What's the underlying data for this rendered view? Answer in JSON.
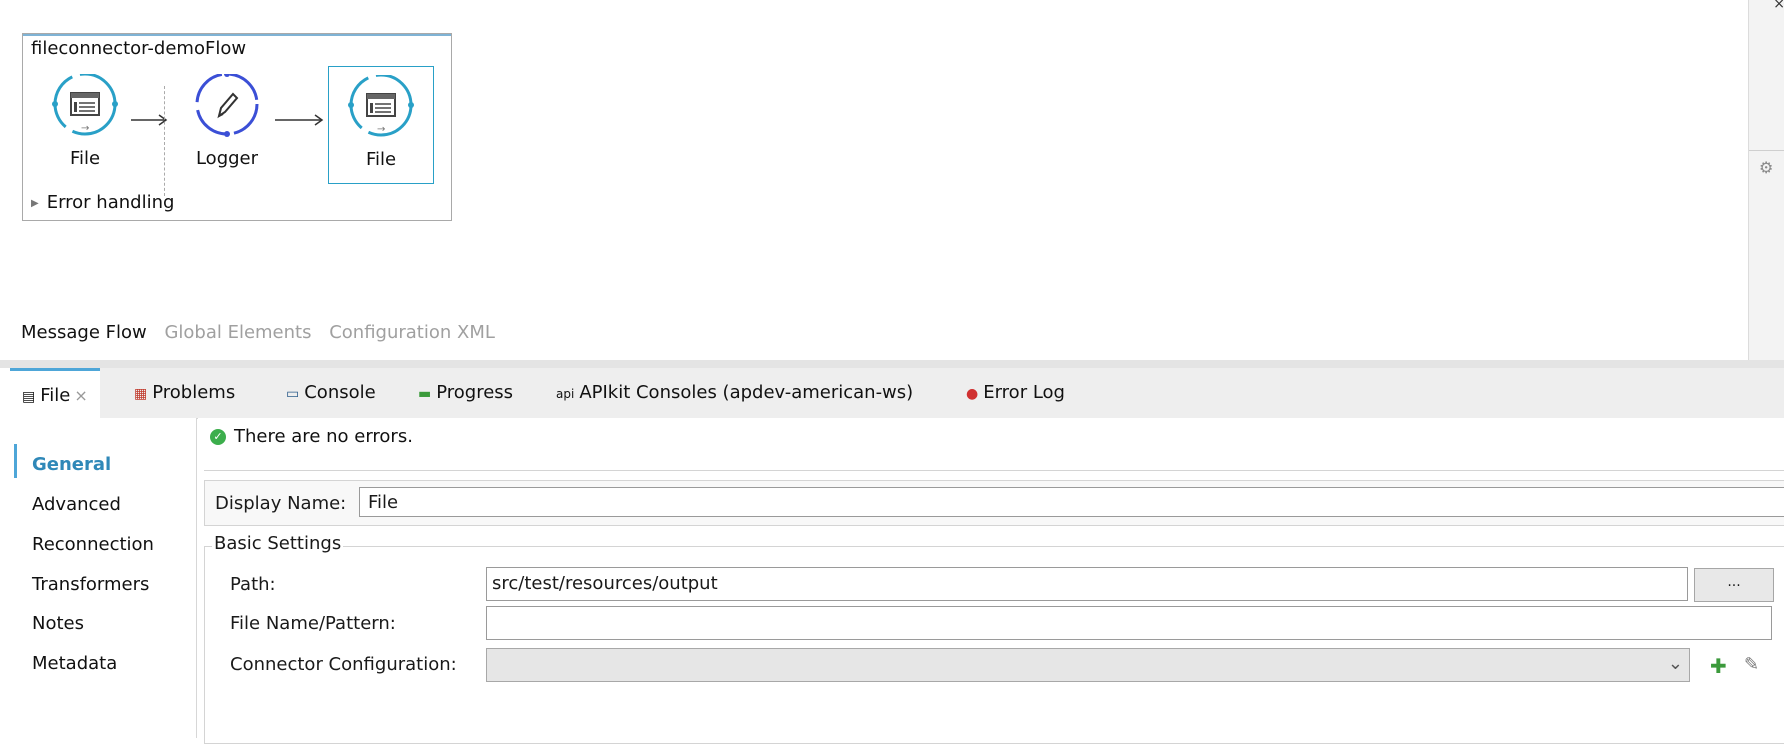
{
  "flow": {
    "title": "fileconnector-demoFlow",
    "nodes": [
      {
        "label": "File",
        "icon": "file-connector-icon"
      },
      {
        "label": "Logger",
        "icon": "logger-pencil-icon"
      },
      {
        "label": "File",
        "icon": "file-connector-icon"
      }
    ],
    "error_handling": "Error handling"
  },
  "canvas_tabs": [
    "Message Flow",
    "Global Elements",
    "Configuration XML"
  ],
  "panel_tabs": [
    {
      "label": "File",
      "icon": "file-icon"
    },
    {
      "label": "Problems",
      "icon": "problems-icon"
    },
    {
      "label": "Console",
      "icon": "console-icon"
    },
    {
      "label": "Progress",
      "icon": "progress-icon"
    },
    {
      "label": "APIkit Consoles (apdev-american-ws)",
      "icon_text": "api"
    },
    {
      "label": "Error Log",
      "icon": "error-log-icon"
    }
  ],
  "sidebar": [
    "General",
    "Advanced",
    "Reconnection",
    "Transformers",
    "Notes",
    "Metadata"
  ],
  "status": "There are no errors.",
  "form": {
    "display_name_label": "Display Name:",
    "display_name_value": "File",
    "basic_settings": "Basic Settings",
    "path_label": "Path:",
    "path_value": "src/test/resources/output",
    "browse_label": "...",
    "filename_label": "File Name/Pattern:",
    "filename_value": "",
    "connector_label": "Connector Configuration:",
    "connector_value": ""
  },
  "colors": {
    "accent": "#4ea6d8",
    "node": "#29a0c7",
    "logger": "#3b4fd6",
    "ok": "#3cae4c"
  }
}
